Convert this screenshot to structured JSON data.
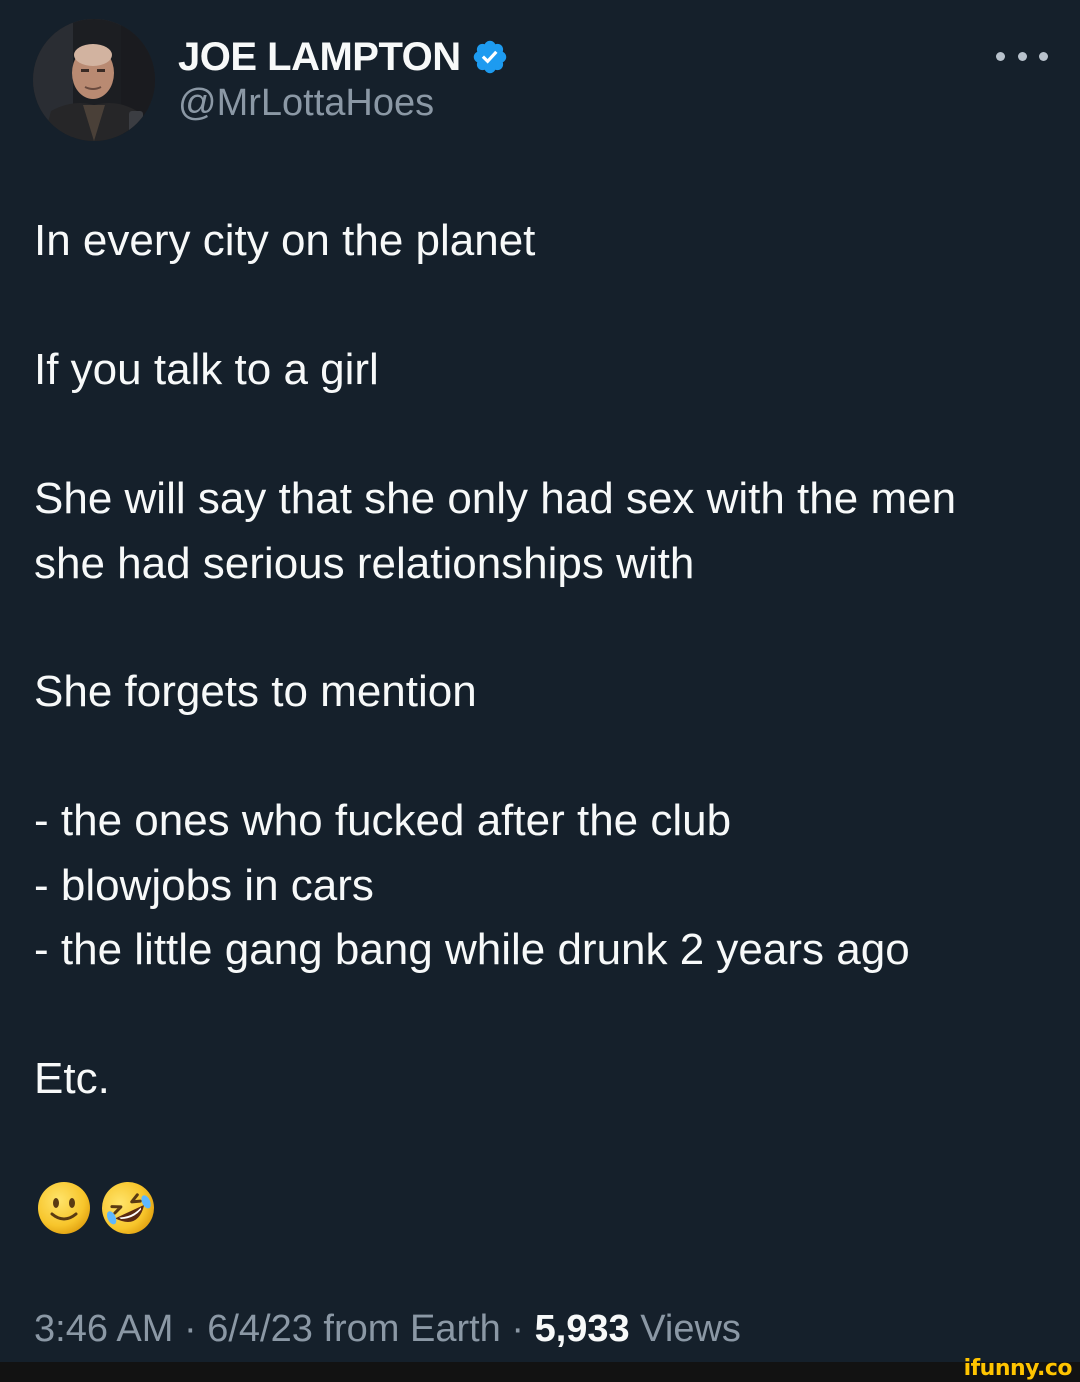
{
  "author": {
    "display_name": "JOE LAMPTON",
    "handle": "@MrLottaHoes"
  },
  "tweet": {
    "lines": [
      "In every city on the planet",
      "If you talk to a girl",
      "She will say that she only had sex with the men",
      "she had serious relationships with",
      "She forgets to mention",
      "- the ones who fucked after the club",
      "- blowjobs in cars",
      "- the little gang bang while drunk 2 years ago",
      "Etc."
    ],
    "emojis": [
      "slightly-smiling-face",
      "rolling-on-the-floor-laughing"
    ]
  },
  "meta": {
    "time": "3:46 AM",
    "separator": "·",
    "date_source": "6/4/23 from Earth",
    "views_count": "5,933",
    "views_label": "Views"
  },
  "watermark": "ifunny.co",
  "colors": {
    "background": "#15202b",
    "text": "#f7f9f9",
    "secondary_text": "#8b98a5",
    "verified_badge": "#1d9bf0",
    "watermark": "#ffc400"
  },
  "icons": {
    "verified": "verified-badge-icon",
    "more": "more-options-icon"
  }
}
